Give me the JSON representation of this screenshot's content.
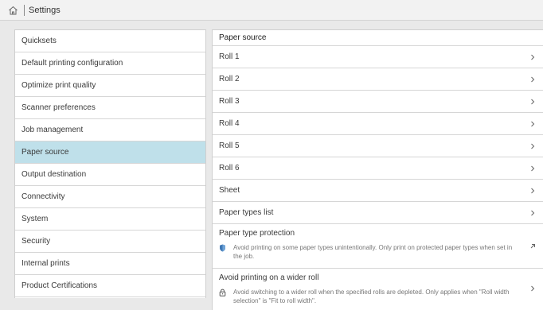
{
  "header": {
    "title": "Settings",
    "home_icon": "home-icon"
  },
  "sidebar": {
    "items": [
      {
        "label": "Quicksets",
        "selected": false
      },
      {
        "label": "Default printing configuration",
        "selected": false
      },
      {
        "label": "Optimize print quality",
        "selected": false
      },
      {
        "label": "Scanner preferences",
        "selected": false
      },
      {
        "label": "Job management",
        "selected": false
      },
      {
        "label": "Paper source",
        "selected": true
      },
      {
        "label": "Output destination",
        "selected": false
      },
      {
        "label": "Connectivity",
        "selected": false
      },
      {
        "label": "System",
        "selected": false
      },
      {
        "label": "Security",
        "selected": false
      },
      {
        "label": "Internal prints",
        "selected": false
      },
      {
        "label": "Product Certifications",
        "selected": false
      }
    ],
    "selected_color": "#bfe0ea"
  },
  "main": {
    "section_title": "Paper source",
    "rows": [
      {
        "label": "Roll 1"
      },
      {
        "label": "Roll 2"
      },
      {
        "label": "Roll 3"
      },
      {
        "label": "Roll 4"
      },
      {
        "label": "Roll 5"
      },
      {
        "label": "Roll 6"
      },
      {
        "label": "Sheet"
      },
      {
        "label": "Paper types list"
      }
    ],
    "protection": {
      "title": "Paper type protection",
      "description": "Avoid printing on some paper types unintentionally. Only print on protected paper types when set in the job.",
      "icon": "shield-icon",
      "action_icon": "external-link-icon"
    },
    "wider_roll": {
      "title": "Avoid printing on a wider roll",
      "description": "Avoid switching to a wider roll when the specified rolls are depleted. Only applies when \"Roll width selection\" is \"Fit to roll width\".",
      "icon": "lock-icon",
      "action_icon": "chevron-right-icon"
    }
  }
}
